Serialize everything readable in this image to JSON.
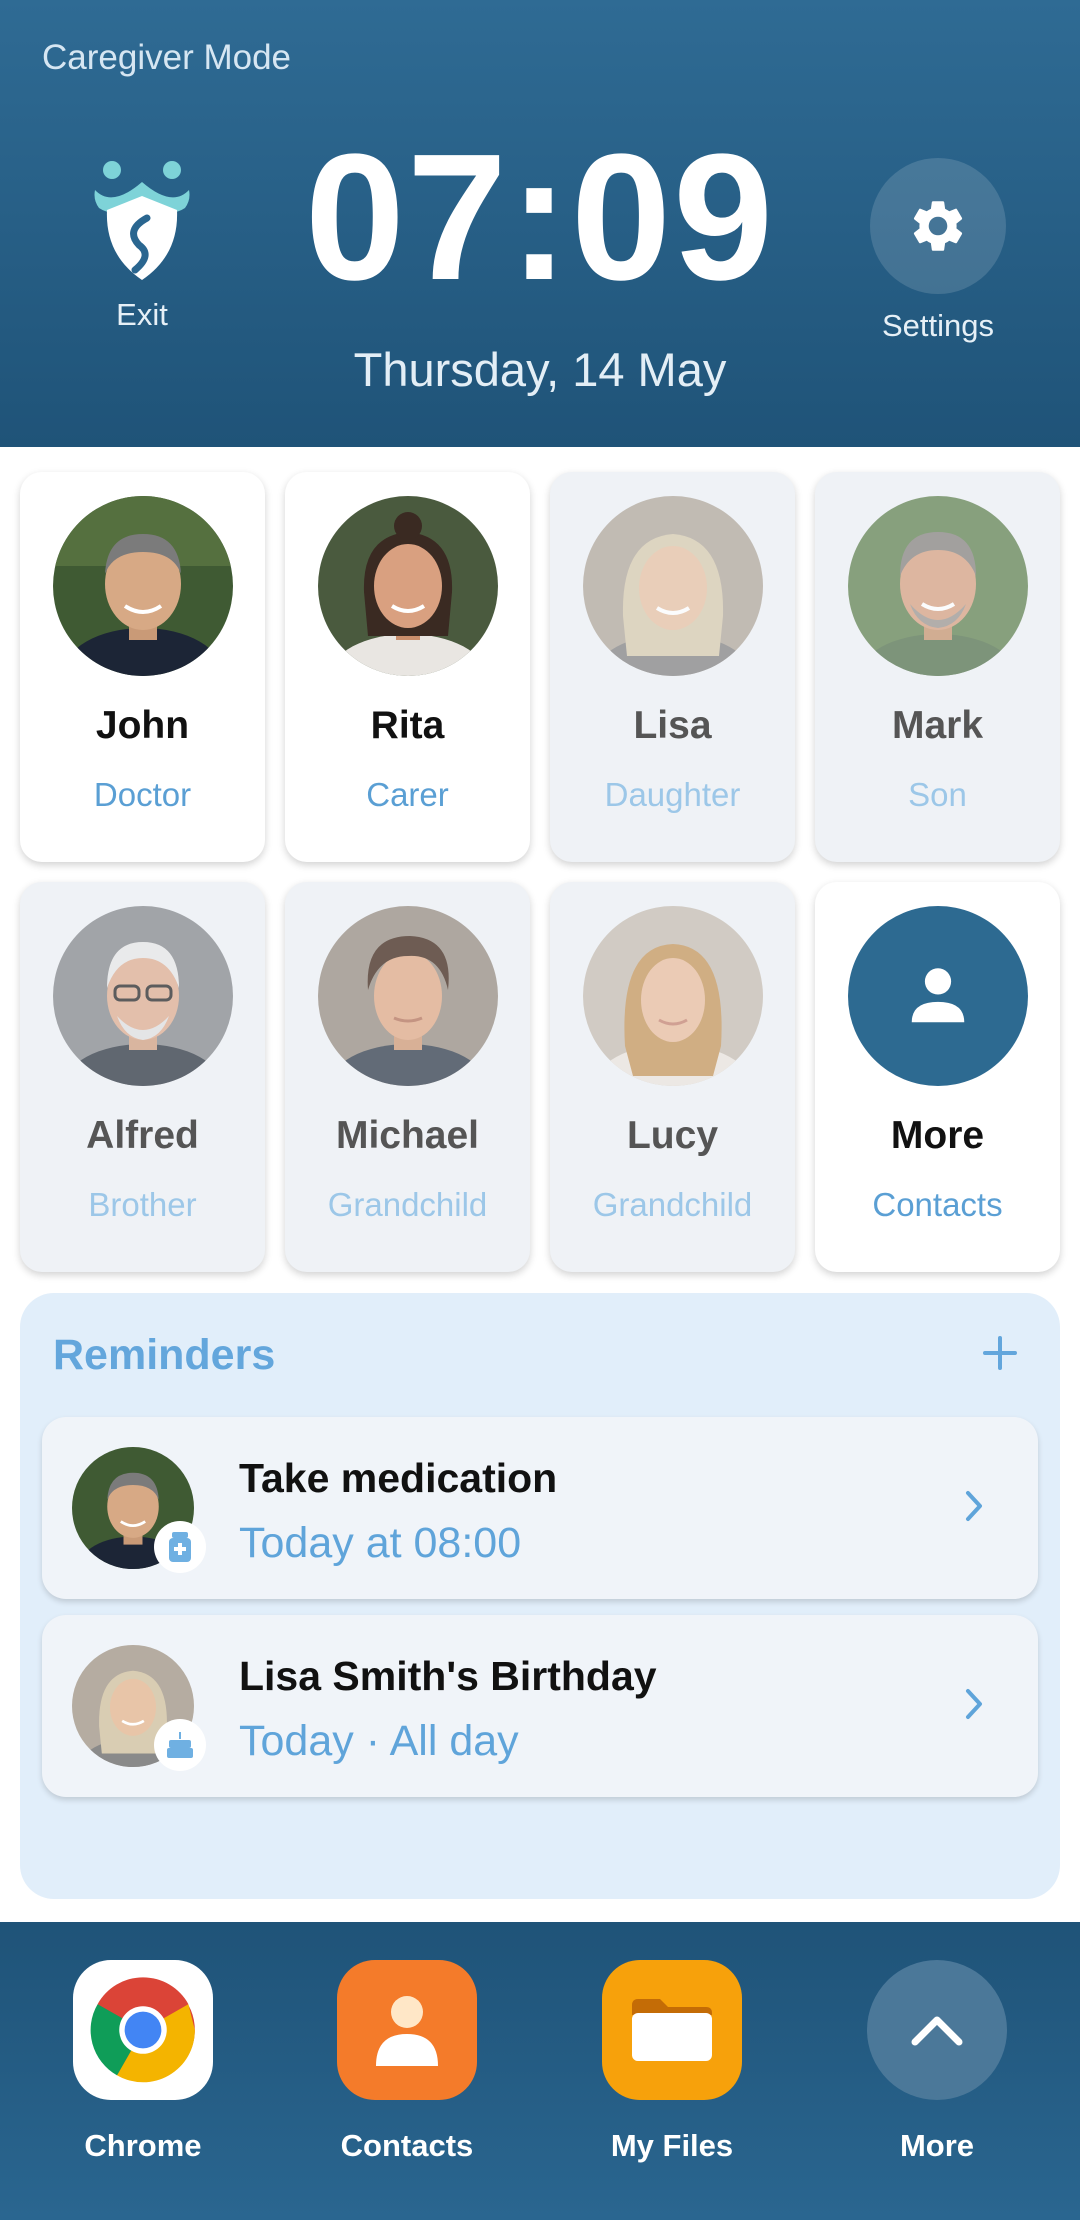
{
  "header": {
    "mode_label": "Caregiver Mode",
    "exit_label": "Exit",
    "time": "07:09",
    "date": "Thursday, 14 May",
    "settings_label": "Settings"
  },
  "contacts": [
    {
      "name": "John",
      "role": "Doctor",
      "state": "active"
    },
    {
      "name": "Rita",
      "role": "Carer",
      "state": "active"
    },
    {
      "name": "Lisa",
      "role": "Daughter",
      "state": "dimmed"
    },
    {
      "name": "Mark",
      "role": "Son",
      "state": "dimmed"
    },
    {
      "name": "Alfred",
      "role": "Brother",
      "state": "dimmed"
    },
    {
      "name": "Michael",
      "role": "Grandchild",
      "state": "dimmed"
    },
    {
      "name": "Lucy",
      "role": "Grandchild",
      "state": "dimmed"
    },
    {
      "name": "More",
      "role": "Contacts",
      "state": "active",
      "icon": "person-icon"
    }
  ],
  "reminders": {
    "title": "Reminders",
    "add_icon": "plus-icon",
    "items": [
      {
        "title": "Take medication",
        "subtitle": "Today at 08:00",
        "badge_icon": "medication-icon"
      },
      {
        "title": "Lisa Smith's Birthday",
        "subtitle": "Today · All day",
        "badge_icon": "birthday-cake-icon"
      }
    ]
  },
  "dock": {
    "apps": [
      {
        "label": "Chrome",
        "icon": "chrome-icon"
      },
      {
        "label": "Contacts",
        "icon": "contacts-icon"
      },
      {
        "label": "My Files",
        "icon": "folder-icon"
      },
      {
        "label": "More",
        "icon": "chevron-up-icon"
      }
    ]
  },
  "colors": {
    "header_bg": "#2f6b94",
    "accent_blue": "#5a9fd4",
    "reminders_bg": "#e1eefa",
    "contacts_orange": "#f47b2a",
    "files_orange": "#f7a10b"
  }
}
